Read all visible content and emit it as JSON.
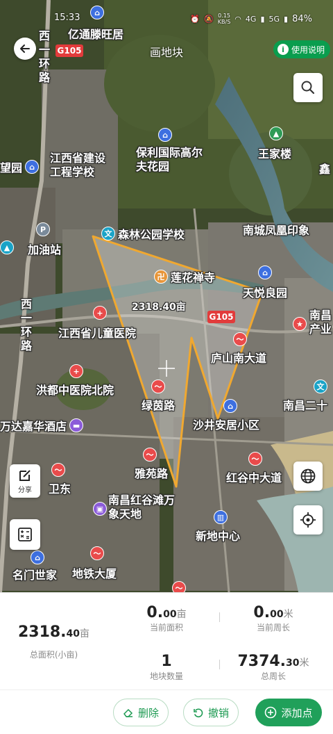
{
  "status_bar": {
    "time": "15:33",
    "speed": "0.15",
    "speed_unit": "KB/S",
    "net1": "4G",
    "net2": "5G",
    "battery": "84%"
  },
  "header": {
    "title": "画地块",
    "help_label": "使用说明"
  },
  "map": {
    "area_overlay": "2318.40亩",
    "road_sign": "G105",
    "road_sign_2": "G105",
    "poi": {
      "yitong": "亿通滕旺居",
      "xihuan": "西一环路",
      "jiangxi_jianshe": "江西省建设工程学校",
      "baoli": "保利国际高尔夫花园",
      "wangjialou": "王家楼",
      "wang_left": "望园",
      "xin_right": "鑫",
      "gas": "加油站",
      "senlin": "森林公园学校",
      "nancheng": "南城凤凰印象",
      "lianhua": "莲花禅寺",
      "tianyue": "天悦良园",
      "xihuan2": "西一环路",
      "ertong": "江西省儿童医院",
      "nanchang_chanye": "南昌产业",
      "lushan": "庐山南大道",
      "hongdu": "洪都中医院北院",
      "lvyin": "绿茵路",
      "shajing": "沙井安居小区",
      "nanchang_er": "南昌二十",
      "wanda": "万达嘉华酒店",
      "yayuan": "雅苑路",
      "hongguzhong": "红谷中大道",
      "weidong": "卫东",
      "nanchang_hong": "南昌红谷滩万象天地",
      "xindi": "新地中心",
      "mingmen": "名门世家",
      "ditie": "地铁大厦"
    },
    "share_label": "分享"
  },
  "stats": {
    "total_area_int": "2318.",
    "total_area_dec": "40",
    "total_area_unit": "亩",
    "total_area_label": "总面积(小亩)",
    "current_area_int": "0.",
    "current_area_dec": "00",
    "current_area_unit": "亩",
    "current_area_label": "当前面积",
    "current_perim_int": "0.",
    "current_perim_dec": "00",
    "current_perim_unit": "米",
    "current_perim_label": "当前周长",
    "plot_count": "1",
    "plot_count_label": "地块数量",
    "total_perim_int": "7374.",
    "total_perim_dec": "30",
    "total_perim_unit": "米",
    "total_perim_label": "总周长"
  },
  "actions": {
    "delete_label": "删除",
    "undo_label": "撤销",
    "add_point_label": "添加点"
  },
  "colors": {
    "accent": "#20a05a",
    "polygon_stroke": "#f0a830",
    "road_sign": "#e23b3b"
  }
}
